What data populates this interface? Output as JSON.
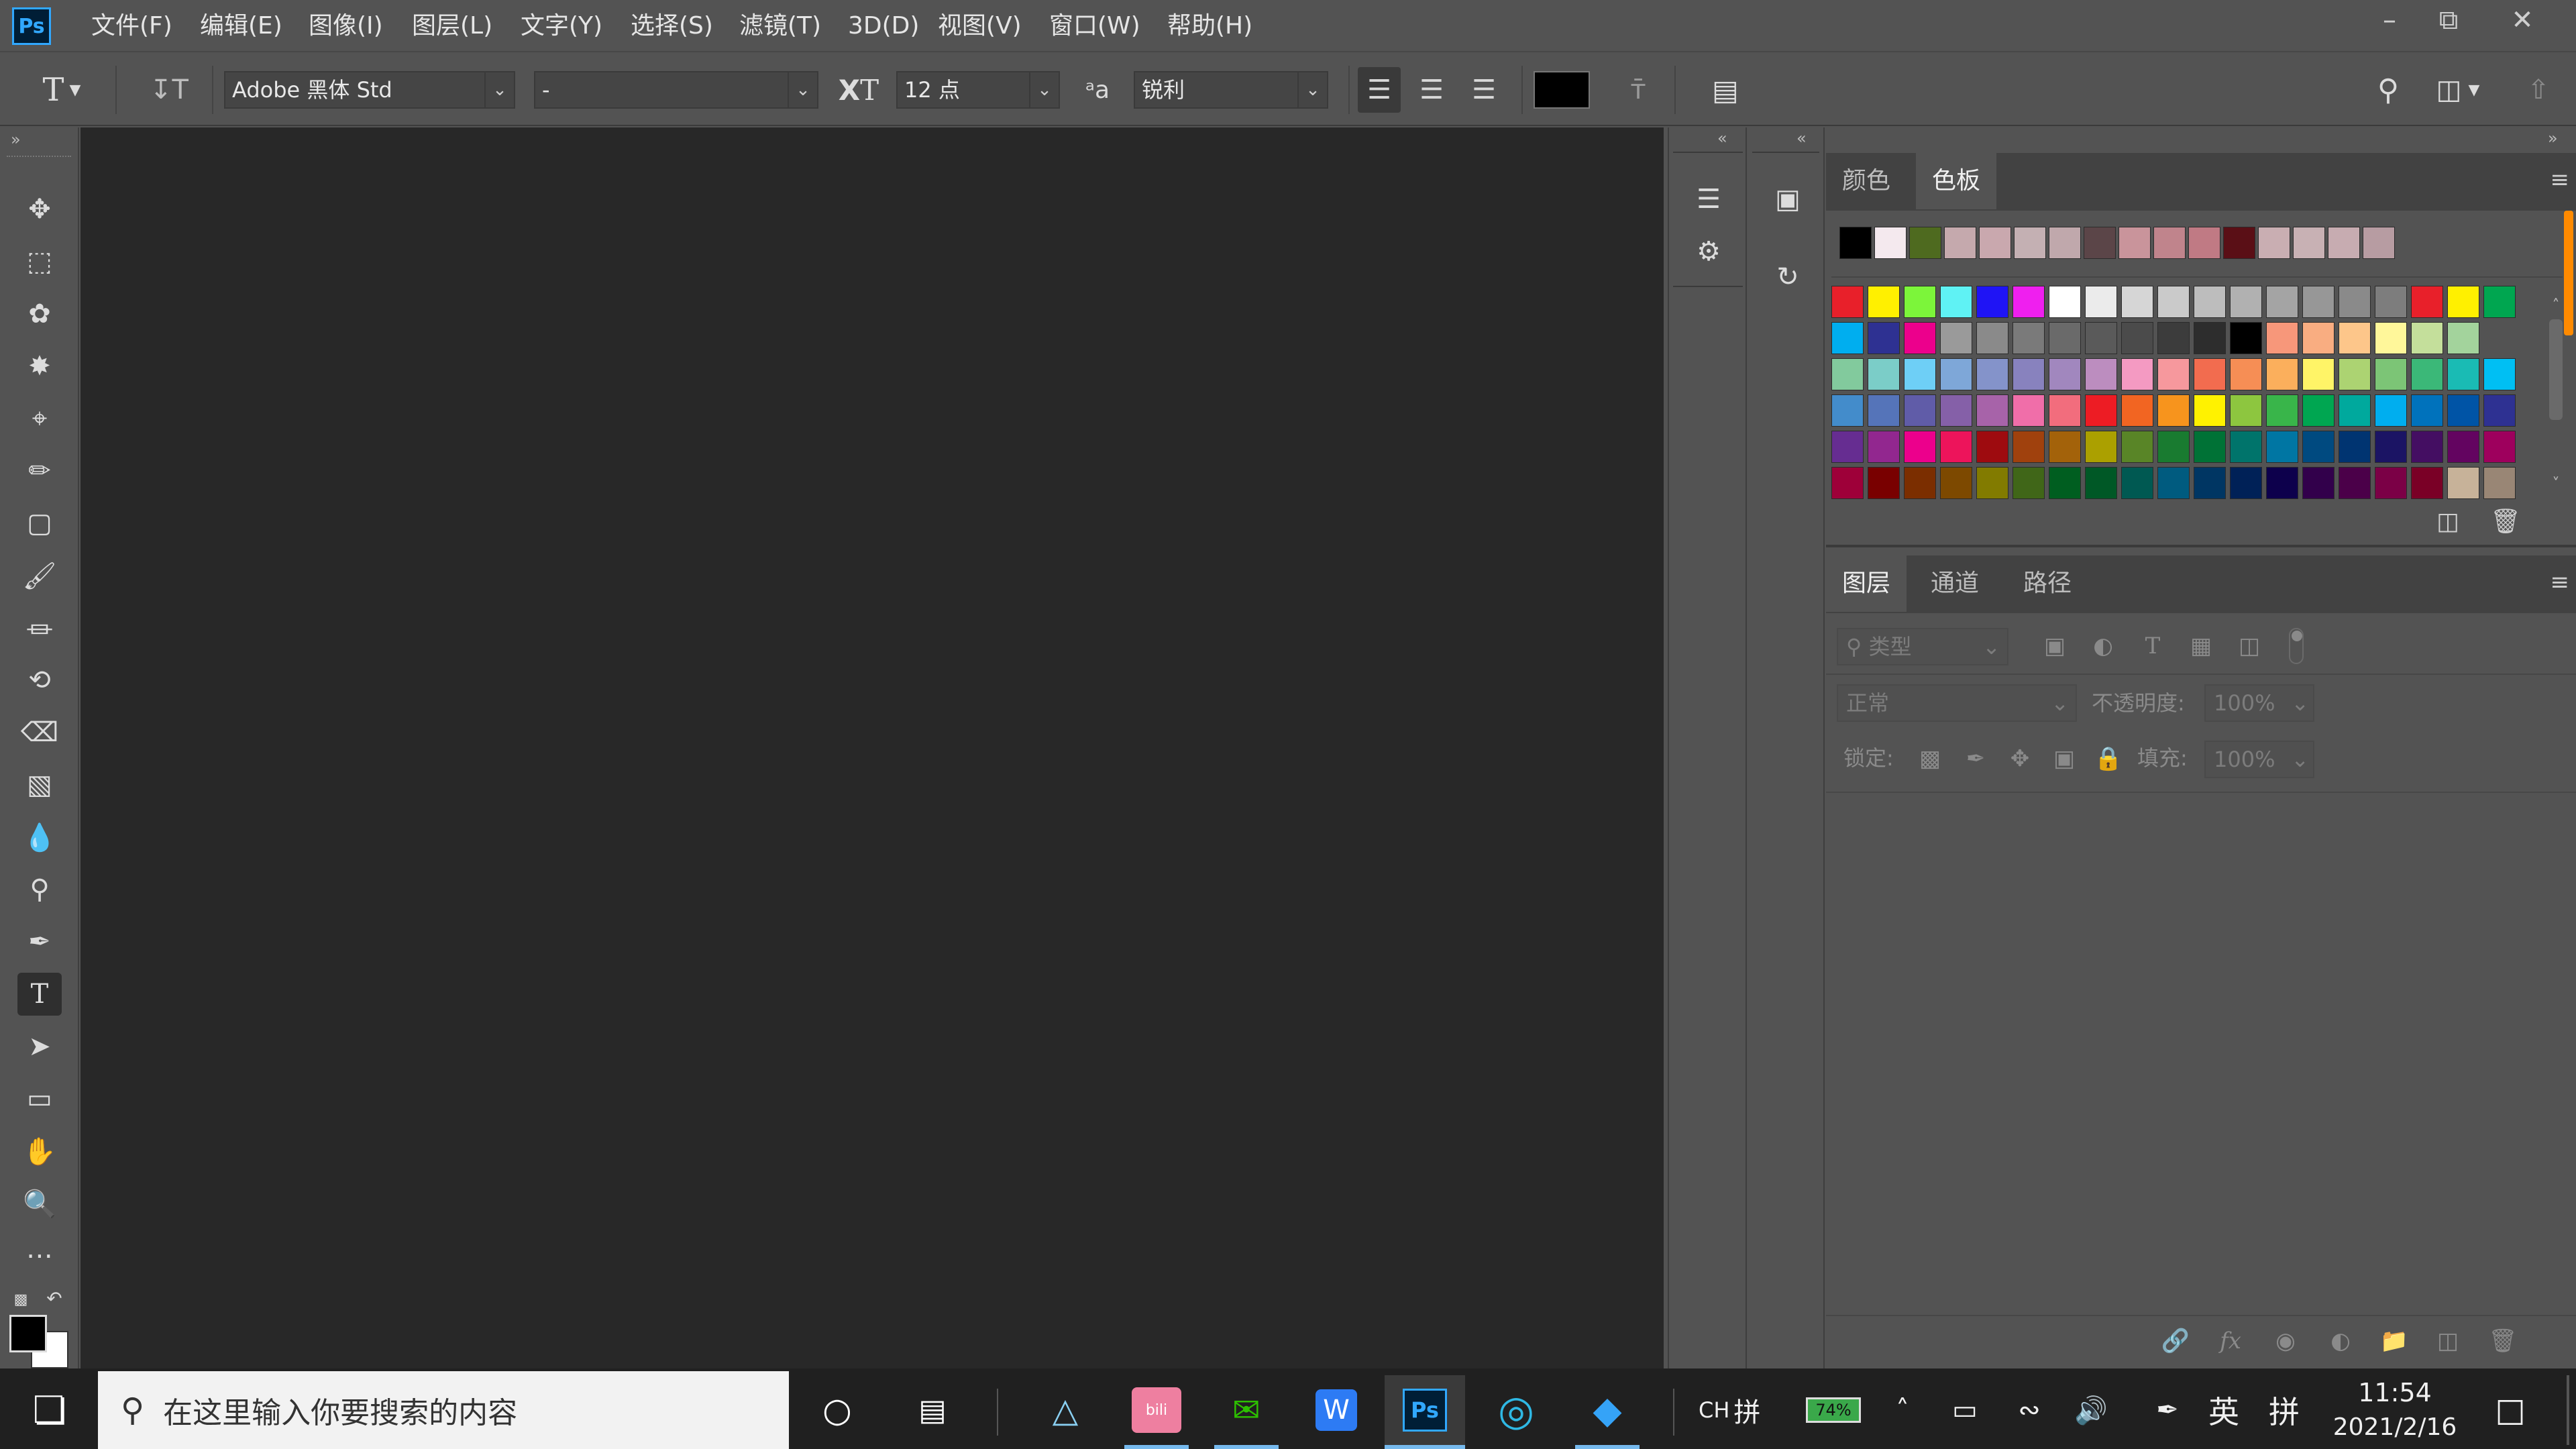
{
  "app": {
    "logo": "Ps"
  },
  "menu": [
    "文件(F)",
    "编辑(E)",
    "图像(I)",
    "图层(L)",
    "文字(Y)",
    "选择(S)",
    "滤镜(T)",
    "3D(D)",
    "视图(V)",
    "窗口(W)",
    "帮助(H)"
  ],
  "options": {
    "font_family": "Adobe 黑体 Std",
    "font_style": "-",
    "font_size": "12 点",
    "antialias": "锐利",
    "text_color": "#000000"
  },
  "swatch_panel": {
    "tabs": [
      "颜色",
      "色板"
    ],
    "active_tab": "色板",
    "recent": [
      "#000000",
      "#f4e9ee",
      "#4e6a1f",
      "#c5a9ad",
      "#c9a8ae",
      "#c4b0b3",
      "#c0a8ac",
      "#5b4548",
      "#c9949b",
      "#c0848c",
      "#c07a84",
      "#5a0f16",
      "#c9aeb2",
      "#c8b1b4",
      "#c7acb1",
      "#b79ca2"
    ],
    "rows": [
      [
        "#e8202a",
        "#fff000",
        "#7cf53a",
        "#5ff2f4",
        "#1f14f5",
        "#ef1fef",
        "#ffffff",
        "#ebebeb",
        "#d6d6d6",
        "#cacaca",
        "#bdbdbd",
        "#b1b1b1",
        "#a4a4a4",
        "#979797",
        "#8a8a8a",
        "#7d7d7d",
        "#e8202a",
        "#fff000",
        "#00a650"
      ],
      [
        "#00aeef",
        "#2e3192",
        "#ec008c",
        "#9a9a9a",
        "#8a8a8a",
        "#7a7a7a",
        "#6a6a6a",
        "#5a5a5a",
        "#4b4b4b",
        "#3c3c3c",
        "#2d2d2d",
        "#000000",
        "#f7977a",
        "#f9ad81",
        "#fdc68a",
        "#fff79a",
        "#c4df9b",
        "#a3d39c"
      ],
      [
        "#82ca9d",
        "#7bcdc8",
        "#6ecff6",
        "#7ea7d8",
        "#8493ca",
        "#8882be",
        "#a187be",
        "#bc8dbf",
        "#f49ac2",
        "#f6989d",
        "#f26c4f",
        "#f68e55",
        "#fbaf5c",
        "#fff467",
        "#acd372",
        "#7cc576",
        "#3bb878",
        "#1abbb4",
        "#00bff3"
      ],
      [
        "#438ccb",
        "#5574b9",
        "#605ca8",
        "#8560a8",
        "#a763a9",
        "#f06ea9",
        "#f26d7d",
        "#ed1c24",
        "#f26522",
        "#f7941d",
        "#fff200",
        "#8dc63f",
        "#39b54a",
        "#00a651",
        "#00a99d",
        "#00aeef",
        "#0072bc",
        "#0054a6",
        "#2e3192"
      ],
      [
        "#662d91",
        "#92278f",
        "#ec008c",
        "#ed145b",
        "#9e0b0f",
        "#a0410d",
        "#a3620a",
        "#aba000",
        "#598527",
        "#197b30",
        "#007236",
        "#00746b",
        "#0076a3",
        "#004a80",
        "#003471",
        "#1b1464",
        "#440e62",
        "#630460",
        "#9e005d"
      ],
      [
        "#9e0039",
        "#790000",
        "#7b2e00",
        "#7d4900",
        "#827b00",
        "#406618",
        "#005e20",
        "#005826",
        "#005952",
        "#005b7f",
        "#003663",
        "#002157",
        "#0d004c",
        "#32004b",
        "#4b0049",
        "#7b0046",
        "#7a0026",
        "#c7b299",
        "#998675"
      ]
    ]
  },
  "layers_panel": {
    "tabs": [
      "图层",
      "通道",
      "路径"
    ],
    "active_tab": "图层",
    "filter_placeholder": "类型",
    "blend_mode": "正常",
    "opacity_label": "不透明度:",
    "opacity_value": "100%",
    "lock_label": "锁定:",
    "fill_label": "填充:",
    "fill_value": "100%"
  },
  "taskbar": {
    "search_placeholder": "在这里输入你要搜索的内容",
    "ime_lang": "CH",
    "ime_mode": "拼",
    "battery": "74%",
    "lang": "英",
    "ime_mode2": "拼",
    "time": "11:54",
    "date": "2021/2/16"
  }
}
